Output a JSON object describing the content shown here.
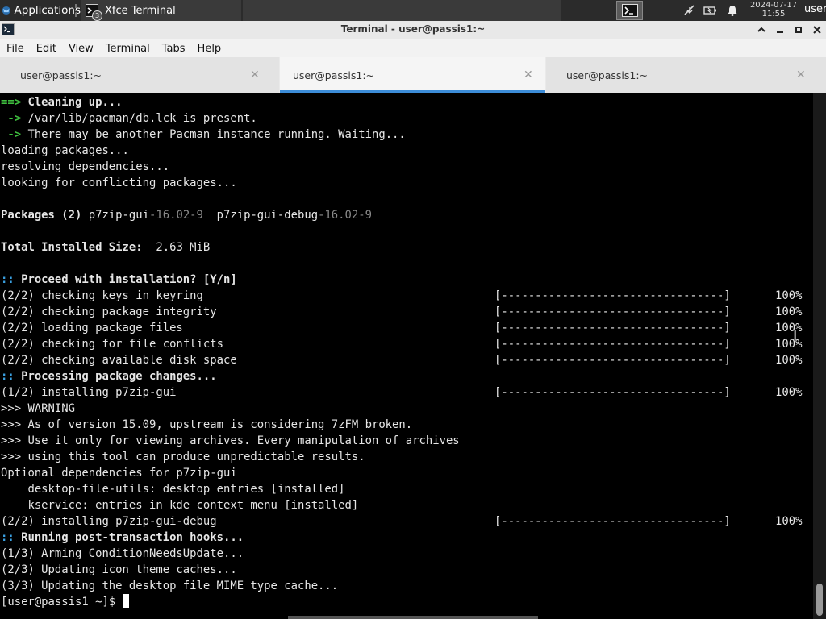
{
  "panel": {
    "applications_label": "Applications",
    "task_title": "Xfce Terminal",
    "task_badge": "3",
    "clock_date": "2024-07-17",
    "clock_time": "11:55",
    "user": "user"
  },
  "window": {
    "title": "Terminal - user@passis1:~"
  },
  "menu": [
    "File",
    "Edit",
    "View",
    "Terminal",
    "Tabs",
    "Help"
  ],
  "tabs": [
    {
      "label": "user@passis1:~",
      "active": false
    },
    {
      "label": "user@passis1:~",
      "active": true
    },
    {
      "label": "user@passis1:~",
      "active": false
    }
  ],
  "terminal": {
    "lines": [
      {
        "segs": [
          [
            "arrow",
            "==>"
          ],
          [
            "b",
            " Cleaning up..."
          ]
        ]
      },
      {
        "segs": [
          [
            "arrow",
            " ->"
          ],
          [
            "",
            " /var/lib/pacman/db.lck is present."
          ]
        ]
      },
      {
        "segs": [
          [
            "arrow",
            " ->"
          ],
          [
            "",
            " There may be another Pacman instance running. Waiting..."
          ]
        ]
      },
      {
        "segs": [
          [
            "",
            "loading packages..."
          ]
        ]
      },
      {
        "segs": [
          [
            "",
            "resolving dependencies..."
          ]
        ]
      },
      {
        "segs": [
          [
            "",
            "looking for conflicting packages..."
          ]
        ]
      },
      {
        "segs": [
          [
            "",
            ""
          ]
        ]
      },
      {
        "segs": [
          [
            "b",
            "Packages (2)"
          ],
          [
            "",
            " p7zip-gui"
          ],
          [
            "dim",
            "-16.02-9"
          ],
          [
            "",
            "  p7zip-gui-debug"
          ],
          [
            "dim",
            "-16.02-9"
          ]
        ]
      },
      {
        "segs": [
          [
            "",
            ""
          ]
        ]
      },
      {
        "segs": [
          [
            "b",
            "Total Installed Size:"
          ],
          [
            "",
            "  2.63 MiB"
          ]
        ]
      },
      {
        "segs": [
          [
            "",
            ""
          ]
        ]
      },
      {
        "segs": [
          [
            "colon",
            "::"
          ],
          [
            "b",
            " Proceed with installation? [Y/n]"
          ]
        ]
      },
      {
        "segs": [
          [
            "",
            "(2/2) checking keys in keyring"
          ]
        ],
        "bar": "[---------------------------------]",
        "pct": "100%"
      },
      {
        "segs": [
          [
            "",
            "(2/2) checking package integrity"
          ]
        ],
        "bar": "[---------------------------------]",
        "pct": "100%"
      },
      {
        "segs": [
          [
            "",
            "(2/2) loading package files"
          ]
        ],
        "bar": "[---------------------------------]",
        "pct": "100%"
      },
      {
        "segs": [
          [
            "",
            "(2/2) checking for file conflicts"
          ]
        ],
        "bar": "[---------------------------------]",
        "pct": "100%"
      },
      {
        "segs": [
          [
            "",
            "(2/2) checking available disk space"
          ]
        ],
        "bar": "[---------------------------------]",
        "pct": "100%"
      },
      {
        "segs": [
          [
            "colon",
            "::"
          ],
          [
            "b",
            " Processing package changes..."
          ]
        ]
      },
      {
        "segs": [
          [
            "",
            "(1/2) installing p7zip-gui"
          ]
        ],
        "bar": "[---------------------------------]",
        "pct": "100%"
      },
      {
        "segs": [
          [
            "",
            ">>> WARNING"
          ]
        ]
      },
      {
        "segs": [
          [
            "",
            ">>> As of version 15.09, upstream is considering 7zFM broken."
          ]
        ]
      },
      {
        "segs": [
          [
            "",
            ">>> Use it only for viewing archives. Every manipulation of archives"
          ]
        ]
      },
      {
        "segs": [
          [
            "",
            ">>> using this tool can produce unpredictable results."
          ]
        ]
      },
      {
        "segs": [
          [
            "",
            "Optional dependencies for p7zip-gui"
          ]
        ]
      },
      {
        "segs": [
          [
            "",
            "    desktop-file-utils: desktop entries [installed]"
          ]
        ]
      },
      {
        "segs": [
          [
            "",
            "    kservice: entries in kde context menu [installed]"
          ]
        ]
      },
      {
        "segs": [
          [
            "",
            "(2/2) installing p7zip-gui-debug"
          ]
        ],
        "bar": "[---------------------------------]",
        "pct": "100%"
      },
      {
        "segs": [
          [
            "colon",
            "::"
          ],
          [
            "b",
            " Running post-transaction hooks..."
          ]
        ]
      },
      {
        "segs": [
          [
            "",
            "(1/3) Arming ConditionNeedsUpdate..."
          ]
        ]
      },
      {
        "segs": [
          [
            "",
            "(2/3) Updating icon theme caches..."
          ]
        ]
      },
      {
        "segs": [
          [
            "",
            "(3/3) Updating the desktop file MIME type cache..."
          ]
        ]
      }
    ],
    "prompt": "[user@passis1 ~]$ "
  }
}
